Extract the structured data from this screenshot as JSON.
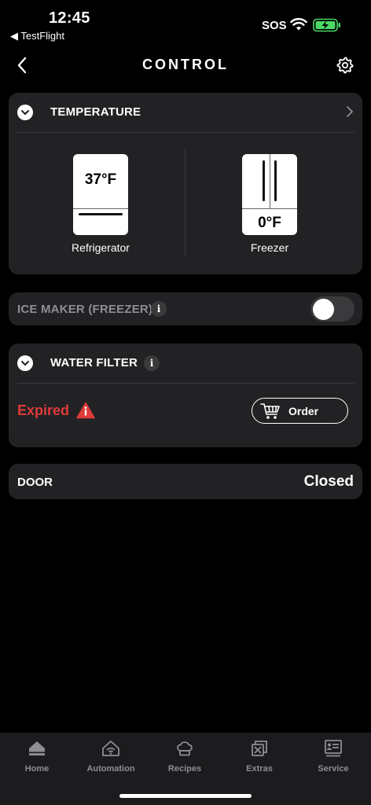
{
  "status_bar": {
    "time": "12:45",
    "back_app": "◀ TestFlight",
    "sos": "SOS"
  },
  "nav": {
    "title": "CONTROL",
    "back_icon": "chevron-left-icon",
    "settings_icon": "gear-icon"
  },
  "temperature": {
    "title": "TEMPERATURE",
    "refrigerator": {
      "temp": "37°F",
      "label": "Refrigerator"
    },
    "freezer": {
      "temp": "0°F",
      "label": "Freezer"
    }
  },
  "ice_maker": {
    "title": "ICE MAKER (FREEZER)",
    "info": "i",
    "enabled": false
  },
  "water_filter": {
    "title": "WATER FILTER",
    "info": "i",
    "status": "Expired",
    "status_color": "#e03a3a",
    "order_label": "Order"
  },
  "door": {
    "title": "DOOR",
    "value": "Closed"
  },
  "tabs": [
    {
      "label": "Home",
      "icon": "home-icon"
    },
    {
      "label": "Automation",
      "icon": "automation-icon"
    },
    {
      "label": "Recipes",
      "icon": "chef-hat-icon"
    },
    {
      "label": "Extras",
      "icon": "extras-icon"
    },
    {
      "label": "Service",
      "icon": "service-icon"
    }
  ]
}
